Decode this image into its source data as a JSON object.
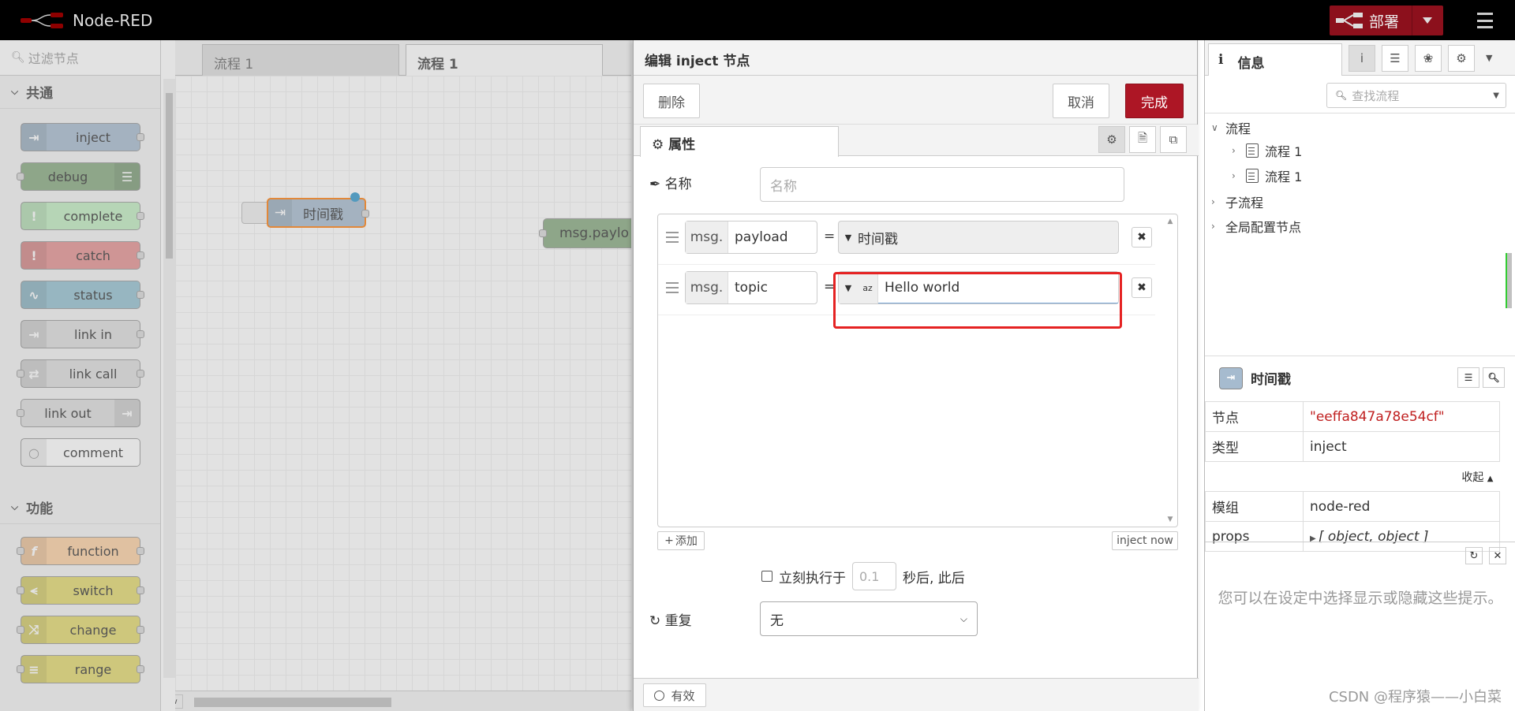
{
  "app": {
    "title": "Node-RED"
  },
  "header": {
    "deploy_label": "部署"
  },
  "palette": {
    "search_placeholder": "过滤节点",
    "categories": [
      {
        "label": "共通",
        "nodes": [
          {
            "label": "inject",
            "color": "#a6bbcf"
          },
          {
            "label": "debug",
            "color": "#87a980"
          },
          {
            "label": "complete",
            "color": "#c0edc0"
          },
          {
            "label": "catch",
            "color": "#e49191"
          },
          {
            "label": "status",
            "color": "#94c1d0"
          },
          {
            "label": "link in",
            "color": "#dddddd"
          },
          {
            "label": "link call",
            "color": "#dddddd"
          },
          {
            "label": "link out",
            "color": "#dddddd"
          },
          {
            "label": "comment",
            "color": "#ffffff"
          }
        ]
      },
      {
        "label": "功能",
        "nodes": [
          {
            "label": "function",
            "color": "#fdd0a2"
          },
          {
            "label": "switch",
            "color": "#e2d96e"
          },
          {
            "label": "change",
            "color": "#e2d96e"
          },
          {
            "label": "range",
            "color": "#e2d96e"
          }
        ]
      }
    ]
  },
  "workspace": {
    "tabs": [
      {
        "label": "流程 1"
      },
      {
        "label": "流程 1"
      }
    ],
    "nodes": [
      {
        "label": "时间戳",
        "type": "inject"
      },
      {
        "label": "msg.paylo",
        "type": "debug"
      }
    ]
  },
  "editor": {
    "title": "编辑 inject 节点",
    "delete_label": "删除",
    "cancel_label": "取消",
    "done_label": "完成",
    "tab_properties": "属性",
    "name_label": "名称",
    "name_placeholder": "名称",
    "props": [
      {
        "prefix": "msg.",
        "key": "payload",
        "eq": "=",
        "value": "时间戳"
      },
      {
        "prefix": "msg.",
        "key": "topic",
        "eq": "=",
        "type_icon": "az",
        "value": "Hello world"
      }
    ],
    "add_label": "添加",
    "inject_now_label": "inject now",
    "once_label": "立刻执行于",
    "once_delay": "0.1",
    "once_suffix": "秒后, 此后",
    "repeat_label": "重复",
    "repeat_value": "无",
    "enabled_label": "有效"
  },
  "sidebar": {
    "tab_info": "信息",
    "search_placeholder": "查找流程",
    "tree": {
      "flows": "流程",
      "flow_items": [
        "流程 1",
        "流程 1"
      ],
      "subflows": "子流程",
      "global_config": "全局配置节点"
    },
    "node": {
      "name": "时间戳",
      "rows": [
        {
          "key": "节点",
          "value": "\"eeffa847a78e54cf\""
        },
        {
          "key": "类型",
          "value": "inject"
        }
      ],
      "collapse_label": "收起",
      "rows2": [
        {
          "key": "模组",
          "value": "node-red"
        },
        {
          "key": "props",
          "value": "[ object, object ]"
        }
      ]
    },
    "help_text": "您可以在设定中选择显示或隐藏这些提示。",
    "watermark": "CSDN @程序猿——小白菜"
  },
  "colors": {
    "accent": "#ad1625",
    "header_bg": "#000000",
    "highlight": "#e52222"
  }
}
